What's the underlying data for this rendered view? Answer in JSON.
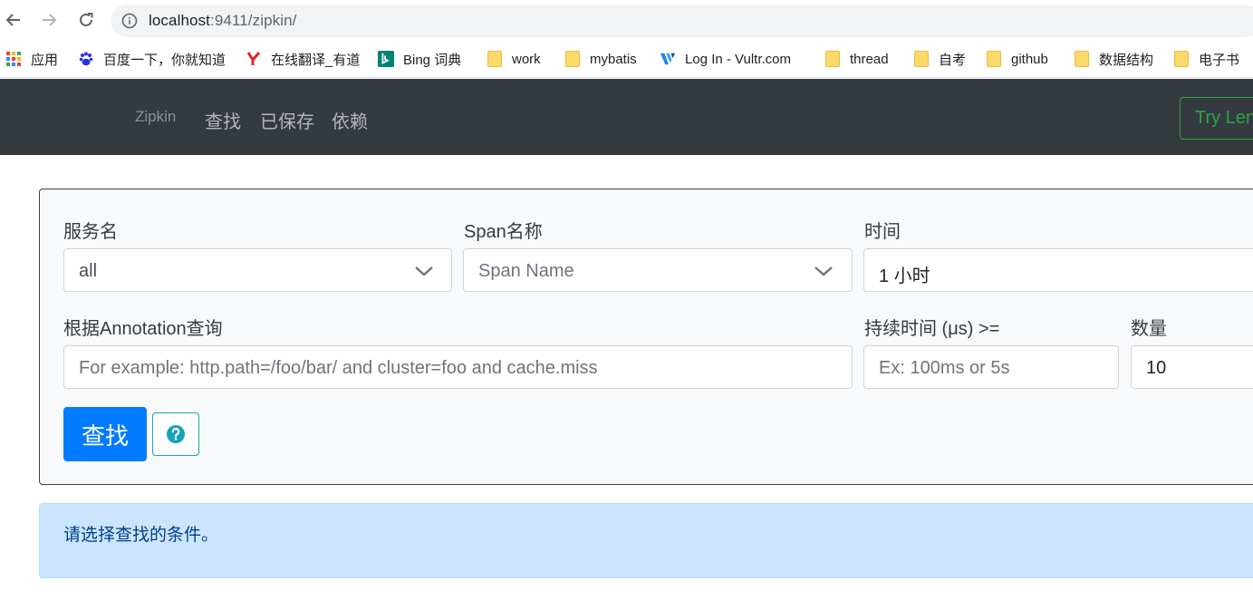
{
  "browser": {
    "url_host": "localhost",
    "url_rest": ":9411/zipkin/",
    "bookmarks": [
      {
        "label": "应用",
        "icon": "apps-grid-icon"
      },
      {
        "label": "百度一下，你就知道",
        "icon": "baidu-paw-icon"
      },
      {
        "label": "在线翻译_有道",
        "icon": "youdao-icon"
      },
      {
        "label": "Bing 词典",
        "icon": "bing-icon"
      },
      {
        "label": "work",
        "icon": "folder-icon"
      },
      {
        "label": "mybatis",
        "icon": "folder-icon"
      },
      {
        "label": "Log In - Vultr.com",
        "icon": "vultr-icon"
      },
      {
        "label": "thread",
        "icon": "folder-icon"
      },
      {
        "label": "自考",
        "icon": "folder-icon"
      },
      {
        "label": "github",
        "icon": "folder-icon"
      },
      {
        "label": "数据结构",
        "icon": "folder-icon"
      },
      {
        "label": "电子书",
        "icon": "folder-icon"
      }
    ]
  },
  "navbar": {
    "brand": "Zipkin",
    "links": [
      "查找",
      "已保存",
      "依赖"
    ],
    "try_lens": "Try Lens UI"
  },
  "search_form": {
    "service_label": "服务名",
    "service_value": "all",
    "span_label": "Span名称",
    "span_value": "Span Name",
    "time_label": "时间",
    "time_value": "1 小时",
    "annotation_label": "根据Annotation查询",
    "annotation_placeholder": "For example: http.path=/foo/bar/ and cluster=foo and cache.miss",
    "duration_label": "持续时间 (μs) >=",
    "duration_placeholder": "Ex: 100ms or 5s",
    "limit_label": "数量",
    "limit_value": "10",
    "search_button": "查找"
  },
  "alert": {
    "message": "请选择查找的条件。"
  },
  "colors": {
    "navbar_bg": "#343a40",
    "primary": "#007bff",
    "success": "#28a745",
    "info": "#17a2b8",
    "alert_bg": "#cce5ff"
  }
}
